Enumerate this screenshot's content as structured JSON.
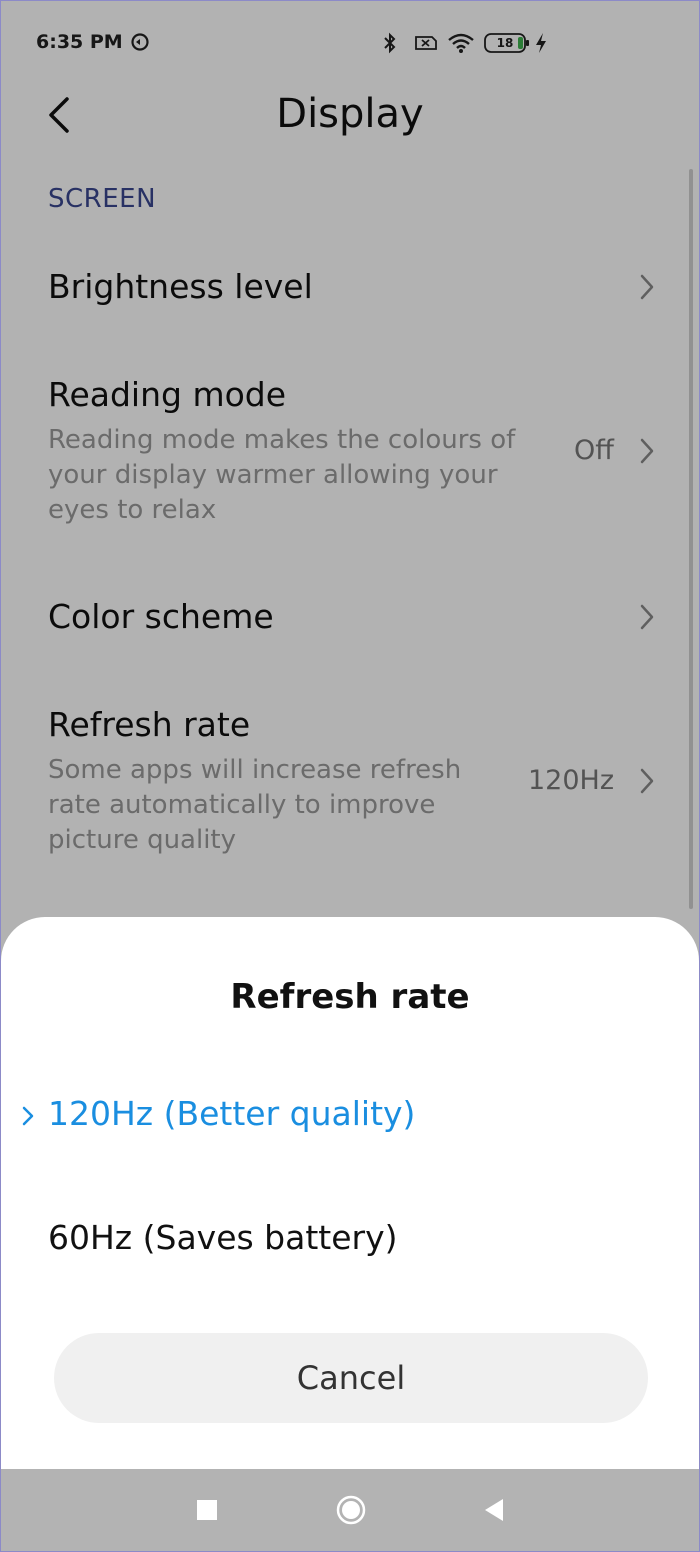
{
  "status_bar": {
    "time": "6:35 PM",
    "battery": "18",
    "icons": [
      "dnd-icon",
      "bluetooth-icon",
      "sim-icon",
      "wifi-icon",
      "battery-icon",
      "charging-icon"
    ]
  },
  "header": {
    "title": "Display",
    "back_icon": "back-arrow-icon"
  },
  "section": {
    "header": "SCREEN"
  },
  "settings": {
    "items": [
      {
        "title": "Brightness level",
        "description": "",
        "value": ""
      },
      {
        "title": "Reading mode",
        "description": "Reading mode makes the colours of your display warmer allowing your eyes to relax",
        "value": "Off"
      },
      {
        "title": "Color scheme",
        "description": "",
        "value": ""
      },
      {
        "title": "Refresh rate",
        "description": "Some apps will increase refresh rate automatically to improve picture quality",
        "value": "120Hz"
      }
    ]
  },
  "dialog": {
    "title": "Refresh rate",
    "options": [
      {
        "label": "120Hz (Better quality)",
        "selected": true
      },
      {
        "label": "60Hz (Saves battery)",
        "selected": false
      }
    ],
    "cancel_label": "Cancel"
  },
  "colors": {
    "accent": "#1a8ee0",
    "section_header": "#3a4790",
    "dim_overlay": "rgba(0,0,0,0.30)"
  },
  "nav_bar": {
    "icons": [
      "recent-apps-icon",
      "home-icon",
      "back-icon"
    ]
  }
}
